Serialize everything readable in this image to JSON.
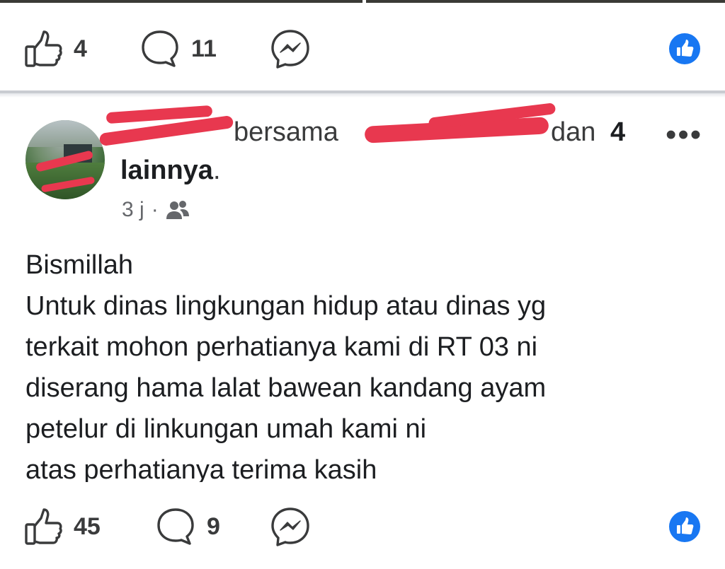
{
  "top_actions": {
    "like_count": "4",
    "comment_count": "11"
  },
  "post": {
    "header": {
      "with_text": "bersama",
      "and_text": "dan",
      "others_count": "4",
      "others_label": "lainnya",
      "trailing_period": "."
    },
    "meta": {
      "time": "3 j",
      "separator": "·",
      "audience_icon": "friends-icon"
    },
    "more_label": "•••",
    "body_lines": [
      "Bismillah",
      "Untuk dinas lingkungan hidup atau dinas yg",
      "terkait mohon perhatianya kami di RT 03 ni",
      "diserang hama lalat  bawean  kandang ayam",
      "petelur di linkungan umah kami ni",
      "atas perhatianya terima kasih"
    ]
  },
  "bottom_actions": {
    "like_count": "45",
    "comment_count": "9"
  },
  "colors": {
    "reaction_blue": "#1877f2",
    "redaction": "#e8384f",
    "text_gray": "#65676b"
  }
}
